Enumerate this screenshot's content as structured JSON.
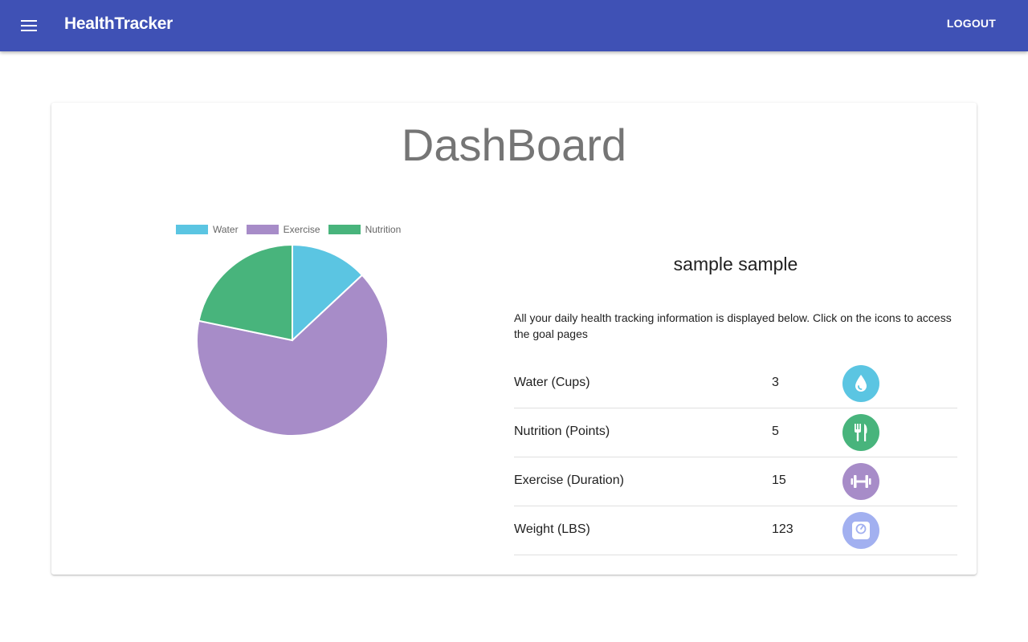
{
  "app": {
    "title": "HealthTracker",
    "logout_label": "LOGOUT",
    "menu_icon": "hamburger-menu-icon"
  },
  "page": {
    "title": "DashBoard",
    "user_name": "sample sample",
    "intro": "All your daily health tracking information is displayed below. Click on the icons to access the goal pages"
  },
  "colors": {
    "appbar": "#3f51b5",
    "water": "#5bc5e2",
    "exercise": "#a78cc8",
    "nutrition": "#48b47c",
    "weight": "#a2b0f0"
  },
  "chart_data": {
    "type": "pie",
    "labels": [
      "Water",
      "Exercise",
      "Nutrition"
    ],
    "values": [
      3,
      15,
      5
    ],
    "colors": [
      "#5bc5e2",
      "#a78cc8",
      "#48b47c"
    ],
    "legend": "top"
  },
  "goals": [
    {
      "label": "Water (Cups)",
      "value": "3",
      "icon": "water-drop-icon",
      "color": "#5bc5e2"
    },
    {
      "label": "Nutrition (Points)",
      "value": "5",
      "icon": "fork-knife-icon",
      "color": "#48b47c"
    },
    {
      "label": "Exercise (Duration)",
      "value": "15",
      "icon": "dumbbell-icon",
      "color": "#a78cc8"
    },
    {
      "label": "Weight (LBS)",
      "value": "123",
      "icon": "scale-icon",
      "color": "#a2b0f0"
    }
  ]
}
